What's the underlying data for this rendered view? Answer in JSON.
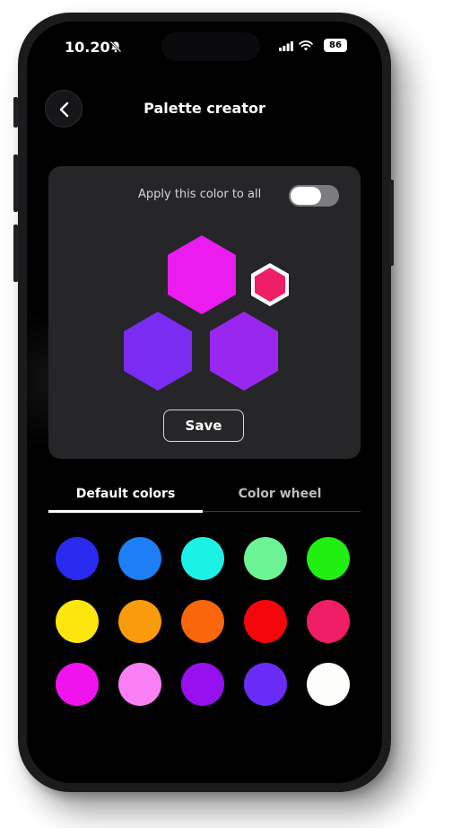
{
  "status_bar": {
    "time": "10.20",
    "battery": "86"
  },
  "header": {
    "title": "Palette creator"
  },
  "editor": {
    "apply_label": "Apply this color to all",
    "apply_to_all": false,
    "hex_colors": {
      "top": "#ea1cf0",
      "left": "#7a2cf2",
      "right": "#9a27f0",
      "selected": "#ee1f66"
    },
    "save_label": "Save"
  },
  "tabs": [
    {
      "label": "Default colors",
      "active": true
    },
    {
      "label": "Color wheel",
      "active": false
    }
  ],
  "swatches": [
    "#2a2bf0",
    "#1d7ef6",
    "#1cf1e6",
    "#6cf494",
    "#1ff012",
    "#fde50e",
    "#fa9a0d",
    "#f9660b",
    "#f4060b",
    "#f01e66",
    "#f113ee",
    "#fb7ff4",
    "#9710f0",
    "#6a2cf7",
    "#fcfcfa"
  ]
}
